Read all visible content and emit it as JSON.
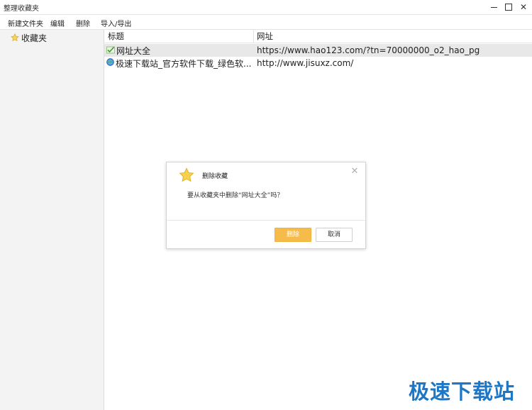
{
  "window": {
    "title": "整理收藏夹"
  },
  "menu": {
    "new_folder": "新建文件夹",
    "edit": "编辑",
    "delete": "删除",
    "import_export": "导入/导出"
  },
  "sidebar": {
    "items": [
      {
        "label": "收藏夹",
        "icon": "star-icon"
      }
    ]
  },
  "table": {
    "columns": [
      "标题",
      "网址"
    ],
    "rows": [
      {
        "title": "网址大全",
        "url": "https://www.hao123.com/?tn=70000000_o2_hao_pg",
        "icon": "check-icon",
        "selected": true
      },
      {
        "title": "极速下载站_官方软件下载_绿色软...",
        "url": "http://www.jisuxz.com/",
        "icon": "globe-icon",
        "selected": false
      }
    ]
  },
  "dialog": {
    "title": "删除收藏",
    "message": "要从收藏夹中删除“网址大全”吗？",
    "confirm_label": "删除",
    "cancel_label": "取消",
    "accent": "#f5bc4c"
  },
  "watermark": {
    "text": "极速下载站"
  }
}
